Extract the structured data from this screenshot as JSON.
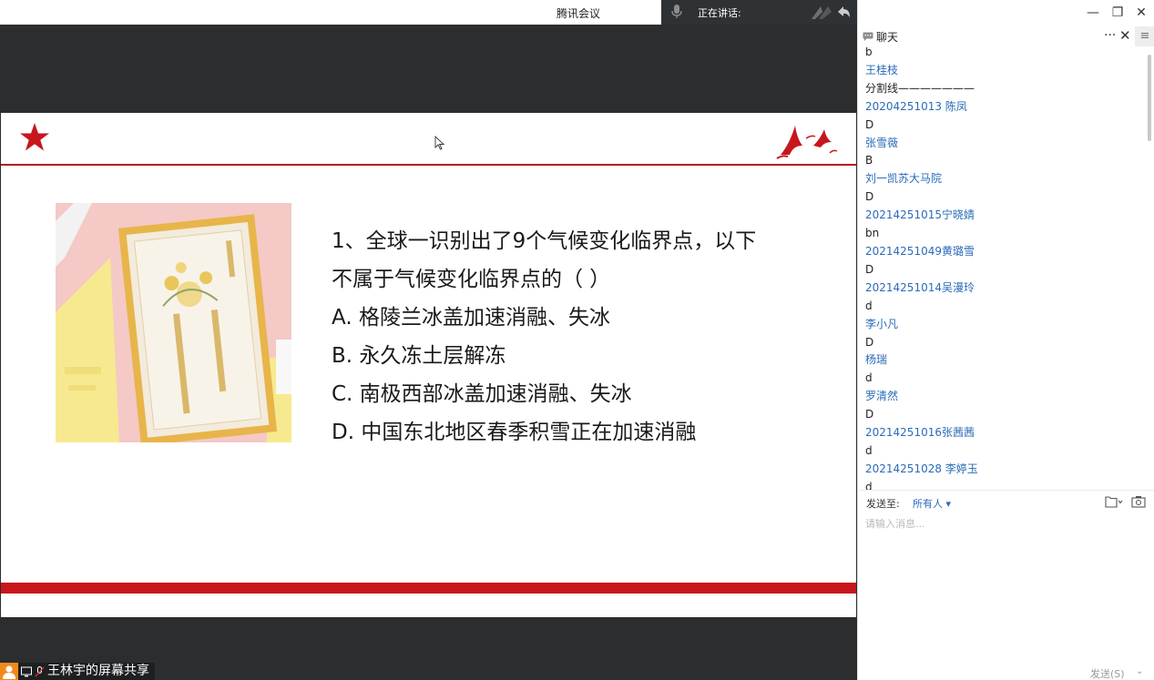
{
  "window": {
    "app_title": "腾讯会议",
    "minimize": "—",
    "restore": "❐",
    "close": "✕"
  },
  "speaking": {
    "label": "正在讲话:"
  },
  "slide": {
    "question_lines": [
      "1、全球一识别出了9个气候变化临界点，以下",
      "不属于气候变化临界点的（  ）",
      "A. 格陵兰冰盖加速消融、失冰",
      "B. 永久冻土层解冻",
      "C. 南极西部冰盖加速消融、失冰",
      "D. 中国东北地区春季积雪正在加速消融"
    ],
    "colors": {
      "accent_red": "#c8161d",
      "dark_bg": "#2b2d2f"
    }
  },
  "share_tag": {
    "label": "王林宇的屏幕共享"
  },
  "chat": {
    "title": "聊天",
    "more": "···",
    "close": "✕",
    "menu": "≡",
    "messages": [
      {
        "kind": "text",
        "value": "b"
      },
      {
        "kind": "name",
        "value": "王桂枝"
      },
      {
        "kind": "text",
        "value": "分割线———————"
      },
      {
        "kind": "name",
        "value": "20204251013 陈凤"
      },
      {
        "kind": "text",
        "value": "D"
      },
      {
        "kind": "name",
        "value": "张雪薇"
      },
      {
        "kind": "text",
        "value": "B"
      },
      {
        "kind": "name",
        "value": "刘一凯苏大马院"
      },
      {
        "kind": "text",
        "value": "D"
      },
      {
        "kind": "name",
        "value": "20214251015宁晓婧"
      },
      {
        "kind": "text",
        "value": "bn"
      },
      {
        "kind": "name",
        "value": "20214251049黄璐雪"
      },
      {
        "kind": "text",
        "value": "D"
      },
      {
        "kind": "name",
        "value": "20214251014吴漫玲"
      },
      {
        "kind": "text",
        "value": "d"
      },
      {
        "kind": "name",
        "value": "李小凡"
      },
      {
        "kind": "text",
        "value": "D"
      },
      {
        "kind": "name",
        "value": "杨瑞"
      },
      {
        "kind": "text",
        "value": "d"
      },
      {
        "kind": "name",
        "value": "罗清然"
      },
      {
        "kind": "text",
        "value": "D"
      },
      {
        "kind": "name",
        "value": "20214251016张茜茜"
      },
      {
        "kind": "text",
        "value": "d"
      },
      {
        "kind": "name",
        "value": "20214251028 李婷玉"
      },
      {
        "kind": "text",
        "value": "d"
      }
    ],
    "send_to_label": "发送至:",
    "send_to_value": "所有人 ▾",
    "input_placeholder": "请输入消息...",
    "send_button": "发送(S)",
    "send_dropdown": "⌄"
  },
  "icons": {
    "mic": "mic-icon",
    "star": "star-icon",
    "birds": "birds-icon",
    "file": "file-icon",
    "screenshot": "screenshot-icon",
    "chat": "chat-icon"
  }
}
